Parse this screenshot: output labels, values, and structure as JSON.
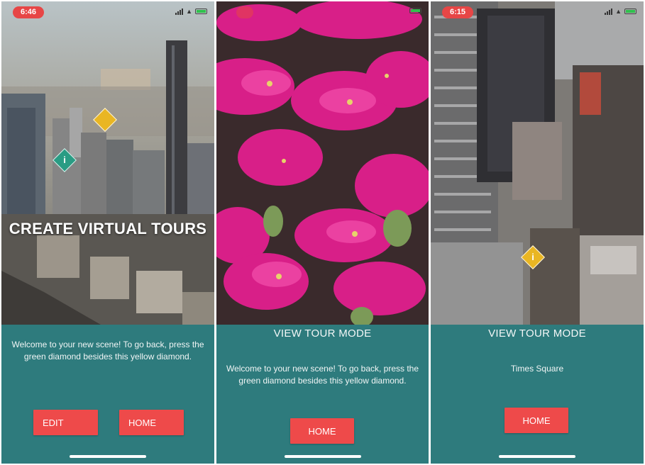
{
  "screens": [
    {
      "status_time": "6:46",
      "hero_text": "CREATE VIRTUAL TOURS",
      "welcome_text": "Welcome to your new scene! To go back, press the green diamond besides this yellow diamond.",
      "edit_label": "EDIT",
      "home_label": "HOME",
      "markers": [
        {
          "color": "yellow",
          "icon": "marker-icon",
          "glyph": ""
        },
        {
          "color": "green",
          "icon": "info-icon",
          "glyph": "i"
        }
      ]
    },
    {
      "mode_title": "VIEW TOUR MODE",
      "welcome_text": "Welcome to your new scene! To go back, press the green diamond besides this yellow diamond.",
      "home_label": "HOME"
    },
    {
      "status_time": "6:15",
      "mode_title": "VIEW TOUR MODE",
      "place_name": "Times Square",
      "home_label": "HOME",
      "markers": [
        {
          "color": "yellow",
          "icon": "info-icon",
          "glyph": "i"
        }
      ]
    }
  ],
  "colors": {
    "panel": "#2e7b7d",
    "button": "#ee4a4a",
    "marker_yellow": "#e9b623",
    "marker_green": "#2a9c84",
    "status_pill": "#e74646"
  }
}
